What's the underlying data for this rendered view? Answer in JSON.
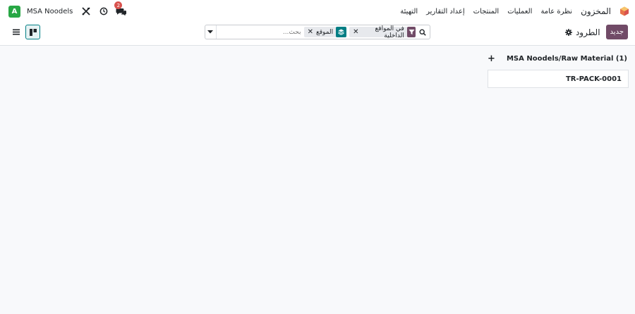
{
  "navbar": {
    "avatar_letter": "A",
    "company": "MSA Noodels",
    "chat_badge": "2",
    "app_name": "المخزون",
    "menu": [
      "نظرة عامة",
      "العمليات",
      "المنتجات",
      "إعداد التقارير",
      "التهيئة"
    ]
  },
  "control_panel": {
    "new_button": "جديد",
    "breadcrumb": "الطرود",
    "facets": [
      {
        "type": "filter",
        "icon": "filter-icon",
        "value": "في المواقع الداخلية"
      },
      {
        "type": "group",
        "icon": "layers-icon",
        "value": "الموقع"
      }
    ],
    "search_placeholder": "بحث..."
  },
  "kanban": {
    "column_title": "MSA Noodels/Raw Material (1)",
    "cards": [
      "TR-PACK-0001"
    ]
  },
  "colors": {
    "brand": "#714b67",
    "accent": "#017e84",
    "avatar": "#28a745",
    "badge": "#d9534f"
  }
}
